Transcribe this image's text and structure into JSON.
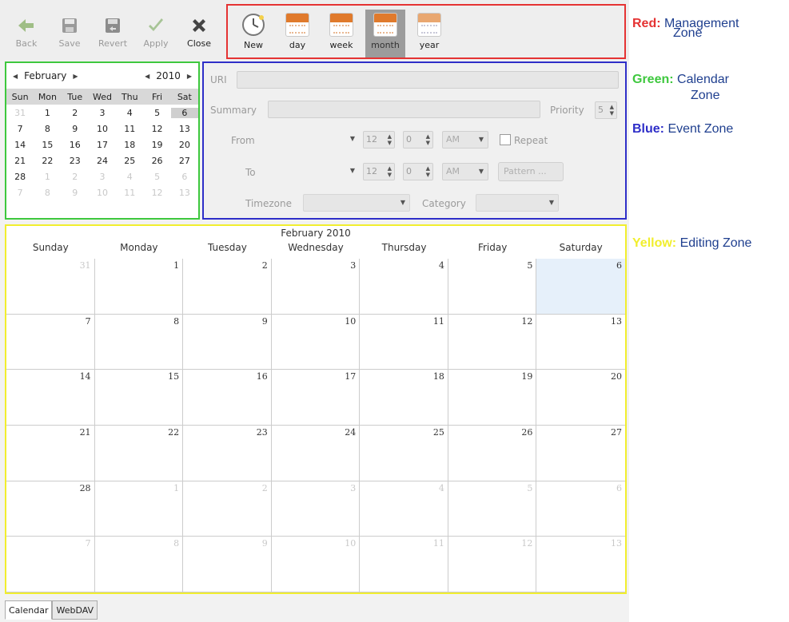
{
  "toolbar": {
    "back": "Back",
    "save": "Save",
    "revert": "Revert",
    "apply": "Apply",
    "close": "Close",
    "new": "New",
    "day": "day",
    "week": "week",
    "month": "month",
    "year": "year",
    "active_view": "month"
  },
  "mini_calendar": {
    "month": "February",
    "year": "2010",
    "weekdays": [
      "Sun",
      "Mon",
      "Tue",
      "Wed",
      "Thu",
      "Fri",
      "Sat"
    ],
    "cells": [
      "31",
      "1",
      "2",
      "3",
      "4",
      "5",
      "6",
      "7",
      "8",
      "9",
      "10",
      "11",
      "12",
      "13",
      "14",
      "15",
      "16",
      "17",
      "18",
      "19",
      "20",
      "21",
      "22",
      "23",
      "24",
      "25",
      "26",
      "27",
      "28",
      "1",
      "2",
      "3",
      "4",
      "5",
      "6",
      "7",
      "8",
      "9",
      "10",
      "11",
      "12",
      "13"
    ],
    "selected": "6"
  },
  "event": {
    "uri_label": "URI",
    "summary_label": "Summary",
    "priority_label": "Priority",
    "priority_value": "5",
    "from_label": "From",
    "to_label": "To",
    "from_hour": "12",
    "from_min": "0",
    "from_ampm": "AM",
    "to_hour": "12",
    "to_min": "0",
    "to_ampm": "AM",
    "repeat_label": "Repeat",
    "pattern_label": "Pattern ...",
    "timezone_label": "Timezone",
    "category_label": "Category"
  },
  "month_view": {
    "title": "February 2010",
    "weekdays": [
      "Sunday",
      "Monday",
      "Tuesday",
      "Wednesday",
      "Thursday",
      "Friday",
      "Saturday"
    ],
    "cells": [
      "31",
      "1",
      "2",
      "3",
      "4",
      "5",
      "6",
      "7",
      "8",
      "9",
      "10",
      "11",
      "12",
      "13",
      "14",
      "15",
      "16",
      "17",
      "18",
      "19",
      "20",
      "21",
      "22",
      "23",
      "24",
      "25",
      "26",
      "27",
      "28",
      "1",
      "2",
      "3",
      "4",
      "5",
      "6",
      "7",
      "8",
      "9",
      "10",
      "11",
      "12",
      "13"
    ],
    "today": "6"
  },
  "tabs": [
    "Calendar",
    "WebDAV"
  ],
  "legend": {
    "red_key": "Red:",
    "red_text_1": "Management",
    "red_text_2": "Zone",
    "green_key": "Green:",
    "green_text_1": "Calendar",
    "green_text_2": "Zone",
    "blue_key": "Blue:",
    "blue_text": "Event Zone",
    "yellow_key": "Yellow:",
    "yellow_text": "Editing Zone"
  },
  "colors": {
    "red": "#e53333",
    "green": "#3ec83e",
    "blue": "#2e2ec8",
    "yellow": "#f1ee2e",
    "today_bg": "#e6f0fa"
  }
}
